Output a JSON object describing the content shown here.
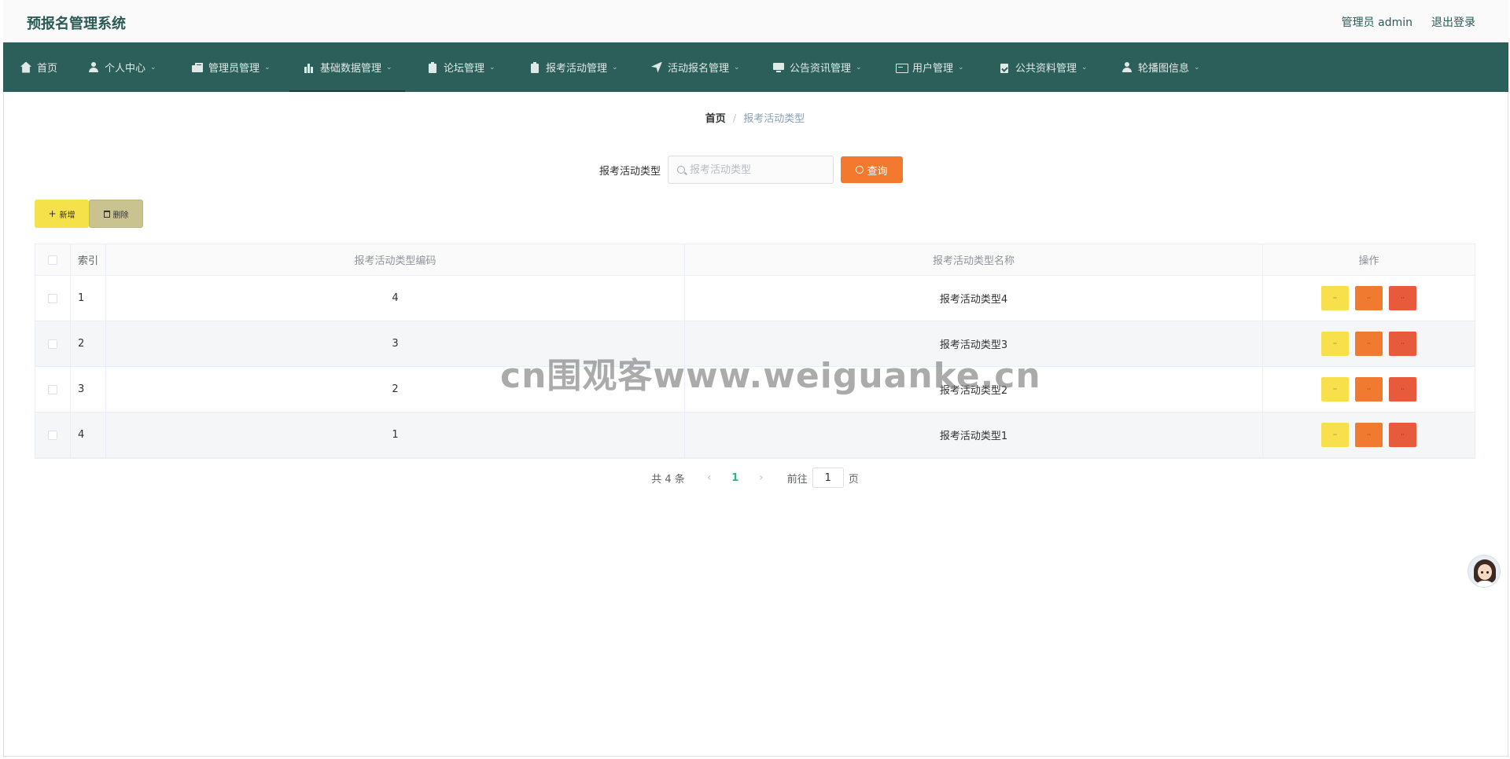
{
  "header": {
    "title": "预报名管理系统",
    "user": "管理员 admin",
    "logout": "退出登录"
  },
  "nav": [
    {
      "label": "首页",
      "icon": "home-icon",
      "has_dropdown": false
    },
    {
      "label": "个人中心",
      "icon": "user-icon",
      "has_dropdown": true
    },
    {
      "label": "管理员管理",
      "icon": "briefcase-icon",
      "has_dropdown": true
    },
    {
      "label": "基础数据管理",
      "icon": "bar-chart-icon",
      "has_dropdown": true,
      "active": true
    },
    {
      "label": "论坛管理",
      "icon": "clipboard-icon",
      "has_dropdown": true
    },
    {
      "label": "报考活动管理",
      "icon": "clipboard-icon",
      "has_dropdown": true
    },
    {
      "label": "活动报名管理",
      "icon": "send-icon",
      "has_dropdown": true
    },
    {
      "label": "公告资讯管理",
      "icon": "monitor-icon",
      "has_dropdown": true
    },
    {
      "label": "用户管理",
      "icon": "id-card-icon",
      "has_dropdown": true
    },
    {
      "label": "公共资料管理",
      "icon": "clipboard-check-icon",
      "has_dropdown": true
    },
    {
      "label": "轮播图信息",
      "icon": "user-icon",
      "has_dropdown": true
    }
  ],
  "breadcrumb": {
    "home": "首页",
    "separator": "/",
    "current": "报考活动类型"
  },
  "search": {
    "label": "报考活动类型",
    "placeholder": "报考活动类型",
    "value": "",
    "button": "查询"
  },
  "actions": {
    "add": "新增",
    "delete": "删除"
  },
  "table": {
    "columns": [
      "索引",
      "报考活动类型编码",
      "报考活动类型名称",
      "操作"
    ],
    "rows": [
      {
        "index": "1",
        "code": "4",
        "name": "报考活动类型4"
      },
      {
        "index": "2",
        "code": "3",
        "name": "报考活动类型3"
      },
      {
        "index": "3",
        "code": "2",
        "name": "报考活动类型2"
      },
      {
        "index": "4",
        "code": "1",
        "name": "报考活动类型1"
      }
    ],
    "op_labels": {
      "view": "··",
      "edit": "··",
      "delete": "··"
    }
  },
  "pagination": {
    "total": "共 4 条",
    "current_page": "1",
    "goto_label": "前往",
    "goto_value": "1",
    "page_suffix": "页"
  },
  "watermark": "cn围观客www.weiguanke.cn",
  "colors": {
    "nav_bg": "#2d5f5a",
    "query_button": "#f2792e",
    "add_button": "#f5e14a",
    "delete_button": "#c9c48f",
    "op_view": "#f8e04d",
    "op_edit": "#f07a2f",
    "op_delete": "#e85a3c",
    "page_active": "#2bb37f"
  }
}
